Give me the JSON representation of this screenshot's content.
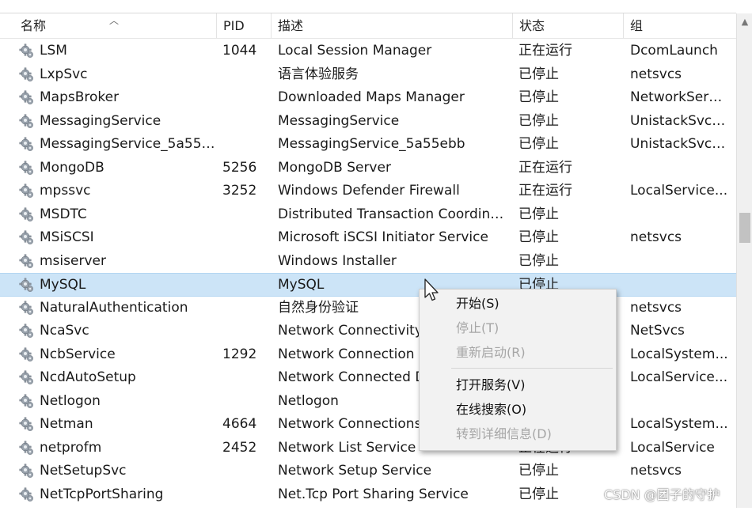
{
  "columns": {
    "name": "名称",
    "pid": "PID",
    "desc": "描述",
    "status": "状态",
    "group": "组"
  },
  "rows": [
    {
      "name": "LSM",
      "pid": "1044",
      "desc": "Local Session Manager",
      "status": "正在运行",
      "group": "DcomLaunch"
    },
    {
      "name": "LxpSvc",
      "pid": "",
      "desc": "语言体验服务",
      "status": "已停止",
      "group": "netsvcs"
    },
    {
      "name": "MapsBroker",
      "pid": "",
      "desc": "Downloaded Maps Manager",
      "status": "已停止",
      "group": "NetworkServ..."
    },
    {
      "name": "MessagingService",
      "pid": "",
      "desc": "MessagingService",
      "status": "已停止",
      "group": "UnistackSvcG..."
    },
    {
      "name": "MessagingService_5a55e...",
      "pid": "",
      "desc": "MessagingService_5a55ebb",
      "status": "已停止",
      "group": "UnistackSvcG..."
    },
    {
      "name": "MongoDB",
      "pid": "5256",
      "desc": "MongoDB Server",
      "status": "正在运行",
      "group": ""
    },
    {
      "name": "mpssvc",
      "pid": "3252",
      "desc": "Windows Defender Firewall",
      "status": "正在运行",
      "group": "LocalService..."
    },
    {
      "name": "MSDTC",
      "pid": "",
      "desc": "Distributed Transaction Coordina...",
      "status": "已停止",
      "group": ""
    },
    {
      "name": "MSiSCSI",
      "pid": "",
      "desc": "Microsoft iSCSI Initiator Service",
      "status": "已停止",
      "group": "netsvcs"
    },
    {
      "name": "msiserver",
      "pid": "",
      "desc": "Windows Installer",
      "status": "已停止",
      "group": ""
    },
    {
      "name": "MySQL",
      "pid": "",
      "desc": "MySQL",
      "status": "已停止",
      "group": "",
      "selected": true
    },
    {
      "name": "NaturalAuthentication",
      "pid": "",
      "desc": "自然身份验证",
      "status": "",
      "group": "netsvcs"
    },
    {
      "name": "NcaSvc",
      "pid": "",
      "desc": "Network Connectivity",
      "status": "",
      "group": "NetSvcs"
    },
    {
      "name": "NcbService",
      "pid": "1292",
      "desc": "Network Connection",
      "status": "",
      "group": "LocalSystem..."
    },
    {
      "name": "NcdAutoSetup",
      "pid": "",
      "desc": "Network Connected D",
      "status": "",
      "group": "LocalService..."
    },
    {
      "name": "Netlogon",
      "pid": "",
      "desc": "Netlogon",
      "status": "",
      "group": ""
    },
    {
      "name": "Netman",
      "pid": "4664",
      "desc": "Network Connections",
      "status": "",
      "group": "LocalSystem..."
    },
    {
      "name": "netprofm",
      "pid": "2452",
      "desc": "Network List Service",
      "status": "正在运行",
      "group": "LocalService"
    },
    {
      "name": "NetSetupSvc",
      "pid": "",
      "desc": "Network Setup Service",
      "status": "已停止",
      "group": "netsvcs"
    },
    {
      "name": "NetTcpPortSharing",
      "pid": "",
      "desc": "Net.Tcp Port Sharing Service",
      "status": "已停止",
      "group": ""
    }
  ],
  "context_menu": {
    "start": "开始(S)",
    "stop": "停止(T)",
    "restart": "重新启动(R)",
    "open_services": "打开服务(V)",
    "search_online": "在线搜索(O)",
    "go_to_details": "转到详细信息(D)"
  },
  "watermark": "CSDN @团子的守护",
  "icons": {
    "service": "gear-icon",
    "cursor": "mouse-pointer-icon",
    "sort": "sort-ascending-icon"
  },
  "colors": {
    "selection": "#cce4f7",
    "disabled_text": "#a6a6a6",
    "menu_bg": "#f2f2f2"
  }
}
